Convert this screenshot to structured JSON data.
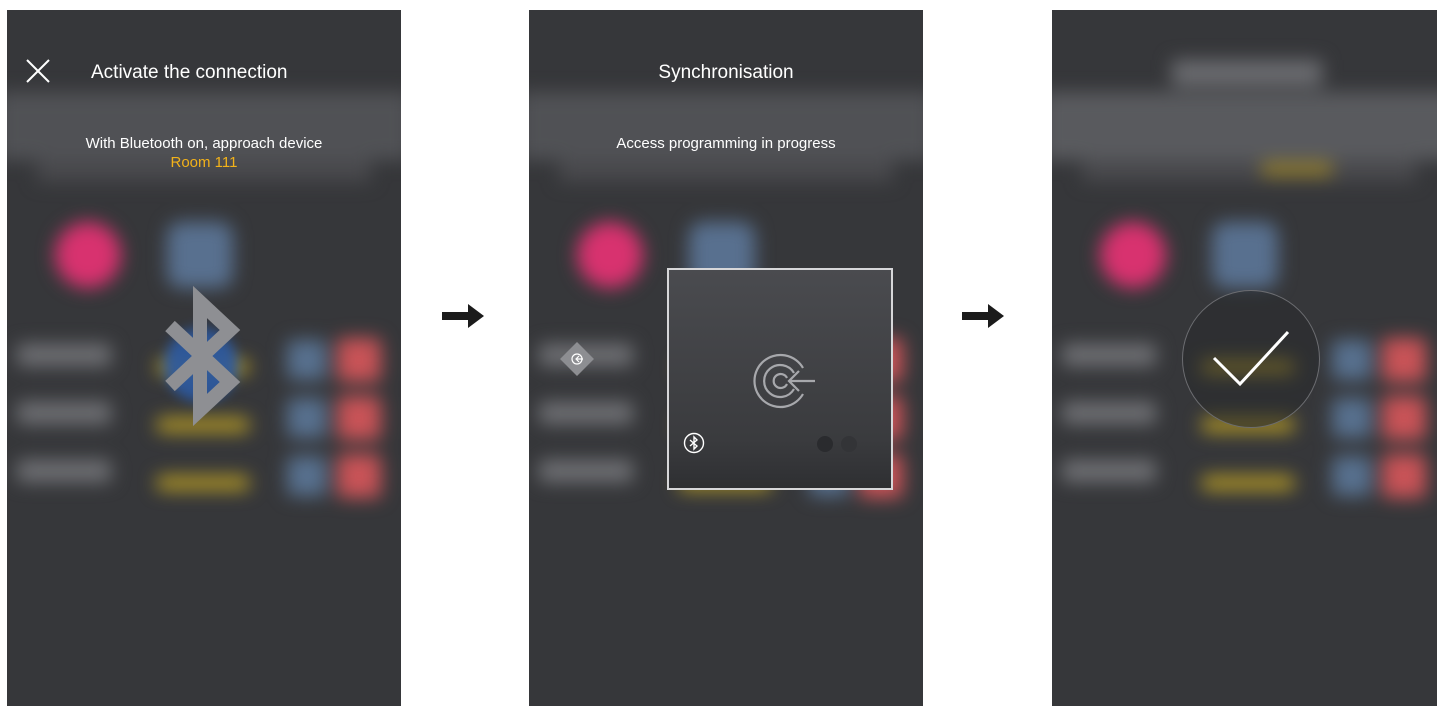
{
  "screen1": {
    "title": "Activate the connection",
    "message": "With Bluetooth on, approach device",
    "device_name": "Room 111"
  },
  "screen2": {
    "title": "Synchronisation",
    "message": "Access programming in progress"
  },
  "screen3": {},
  "colors": {
    "background": "#36373a",
    "accent_device": "#f2b21a",
    "bluetooth_glow": "#2c5aa3",
    "text": "#ffffff"
  },
  "icons": {
    "close": "close-icon",
    "bluetooth": "bluetooth-icon",
    "sync": "sync-target-icon",
    "success": "checkmark-icon",
    "step_arrow": "arrow-right-icon"
  }
}
